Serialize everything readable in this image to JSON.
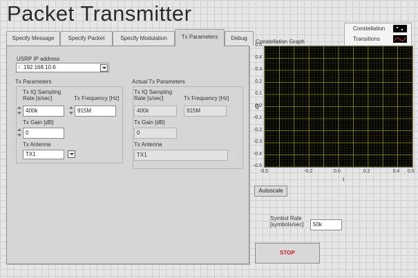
{
  "window": {
    "title": "Packet Transmitter"
  },
  "tabs": [
    {
      "label": "Specify Message"
    },
    {
      "label": "Specify Packet"
    },
    {
      "label": "Specify Modulation"
    },
    {
      "label": "Tx Parameters",
      "active": true
    },
    {
      "label": "Debug"
    }
  ],
  "usrp": {
    "label": "USRP IP address",
    "value": "192.168.10.6"
  },
  "tx_params": {
    "title": "Tx Parameters",
    "iq_rate_label": "Tx IQ Sampling\nRate [s/sec]",
    "iq_rate_value": "400k",
    "freq_label": "Tx Frequency [Hz]",
    "freq_value": "915M",
    "gain_label": "Tx Gain [dB]",
    "gain_value": "0",
    "antenna_label": "Tx Antenna",
    "antenna_value": "TX1"
  },
  "actual_params": {
    "title": "Actual Tx Parameters",
    "iq_rate_label": "Tx IQ Sampling\nRate [s/sec]",
    "iq_rate_value": "400k",
    "freq_label": "Tx Frequency [Hz]",
    "freq_value": "915M",
    "gain_label": "Tx Gain [dB]",
    "gain_value": "0",
    "antenna_label": "Tx Antenna",
    "antenna_value": "TX1"
  },
  "graph": {
    "title": "Constellation Graph",
    "y_label": "Q",
    "x_label": "I",
    "y_ticks": [
      "0.5",
      "0.4",
      "0.3",
      "0.2",
      "0.1",
      "0.0",
      "-0.1",
      "-0.2",
      "-0.3",
      "-0.4",
      "-0.5"
    ],
    "x_ticks": [
      "-0.5",
      "-0.2",
      "0.0",
      "0.2",
      "0.4",
      "0.5"
    ],
    "x_tick_values": [
      -0.5,
      -0.2,
      0.0,
      0.2,
      0.4,
      0.5
    ],
    "range": [
      -0.5,
      0.5
    ],
    "legend": [
      {
        "name": "Constellation",
        "icon": "dots-icon"
      },
      {
        "name": "Transitions",
        "icon": "wave-icon"
      }
    ],
    "plot_bg": "#000000",
    "grid_color": "#b8b800",
    "autoscale_label": "Autoscale"
  },
  "symbol_rate": {
    "label": "Symbol Rate\n[symbols/sec]",
    "value": "50k"
  },
  "stop": {
    "label": "STOP",
    "color": "#cc2222"
  }
}
